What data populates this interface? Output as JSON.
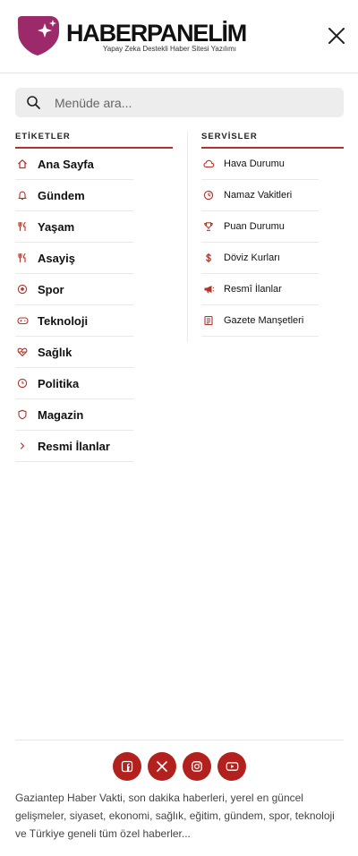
{
  "brand": {
    "name": "HABERPANELİM",
    "tagline": "Yapay Zeka Destekli Haber Sitesi Yazılımı",
    "accent": "#b3332b",
    "logo_color": "#9c2a6a"
  },
  "header": {
    "close_icon": "close-icon"
  },
  "search": {
    "placeholder": "Menüde ara...",
    "value": "",
    "icon": "search-icon"
  },
  "tags": {
    "title": "ETİKETLER",
    "items": [
      {
        "label": "Ana Sayfa",
        "icon": "home-icon"
      },
      {
        "label": "Gündem",
        "icon": "bell-icon"
      },
      {
        "label": "Yaşam",
        "icon": "utensils-icon"
      },
      {
        "label": "Asayiş",
        "icon": "utensils-icon"
      },
      {
        "label": "Spor",
        "icon": "soccer-ball-icon"
      },
      {
        "label": "Teknoloji",
        "icon": "gamepad-icon"
      },
      {
        "label": "Sağlık",
        "icon": "heart-pulse-icon"
      },
      {
        "label": "Politika",
        "icon": "clock-icon"
      },
      {
        "label": "Magazin",
        "icon": "shield-icon"
      },
      {
        "label": "Resmi İlanlar",
        "icon": "chevron-right-icon"
      }
    ]
  },
  "services": {
    "title": "SERVİSLER",
    "items": [
      {
        "label": "Hava Durumu",
        "icon": "cloud-icon"
      },
      {
        "label": "Namaz Vakitleri",
        "icon": "pie-clock-icon"
      },
      {
        "label": "Puan Durumu",
        "icon": "trophy-icon"
      },
      {
        "label": "Döviz Kurları",
        "icon": "dollar-icon"
      },
      {
        "label": "Resmî İlanlar",
        "icon": "megaphone-icon"
      },
      {
        "label": "Gazete Manşetleri",
        "icon": "newspaper-icon"
      }
    ]
  },
  "footer": {
    "socials": [
      {
        "name": "facebook",
        "icon": "facebook-icon"
      },
      {
        "name": "x",
        "icon": "x-icon"
      },
      {
        "name": "instagram",
        "icon": "instagram-icon"
      },
      {
        "name": "youtube",
        "icon": "youtube-icon"
      }
    ],
    "description": "Gaziantep Haber Vakti, son dakika haberleri, yerel en güncel gelişmeler, siyaset, ekonomi, sağlık, eğitim, gündem, spor, teknoloji ve Türkiye geneli tüm özel haberler..."
  }
}
